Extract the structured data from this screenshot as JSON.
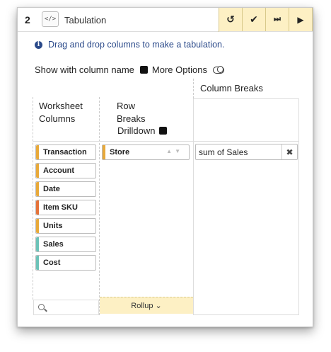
{
  "header": {
    "step_number": "2",
    "code_label": "</>",
    "title": "Tabulation",
    "tools": [
      {
        "name": "undo-icon",
        "glyph": "↺"
      },
      {
        "name": "check-icon",
        "glyph": "✔"
      },
      {
        "name": "step-forward-icon",
        "glyph": "⏭"
      },
      {
        "name": "play-icon",
        "glyph": "▶"
      }
    ]
  },
  "info": {
    "text": "Drag and drop columns to make a tabulation."
  },
  "options": {
    "show_column_name": "Show with column name",
    "more_options": "More Options"
  },
  "worksheet": {
    "header_line1": "Worksheet",
    "header_line2": "Columns",
    "columns": [
      {
        "label": "Transaction",
        "color": "#e8a93a"
      },
      {
        "label": "Account",
        "color": "#e8a93a"
      },
      {
        "label": "Date",
        "color": "#e8a93a"
      },
      {
        "label": "Item SKU",
        "color": "#e5733a"
      },
      {
        "label": "Units",
        "color": "#e8a93a"
      },
      {
        "label": "Sales",
        "color": "#6cc3b8"
      },
      {
        "label": "Cost",
        "color": "#6cc3b8"
      }
    ]
  },
  "row_breaks": {
    "header_line1": "Row",
    "header_line2": "Breaks",
    "drilldown": "Drilldown",
    "items": [
      {
        "label": "Store",
        "color": "#e8a93a"
      }
    ],
    "rollup": "Rollup ⌄"
  },
  "column_breaks": {
    "label": "Column Breaks",
    "items": [
      {
        "label": "sum of Sales"
      }
    ]
  }
}
